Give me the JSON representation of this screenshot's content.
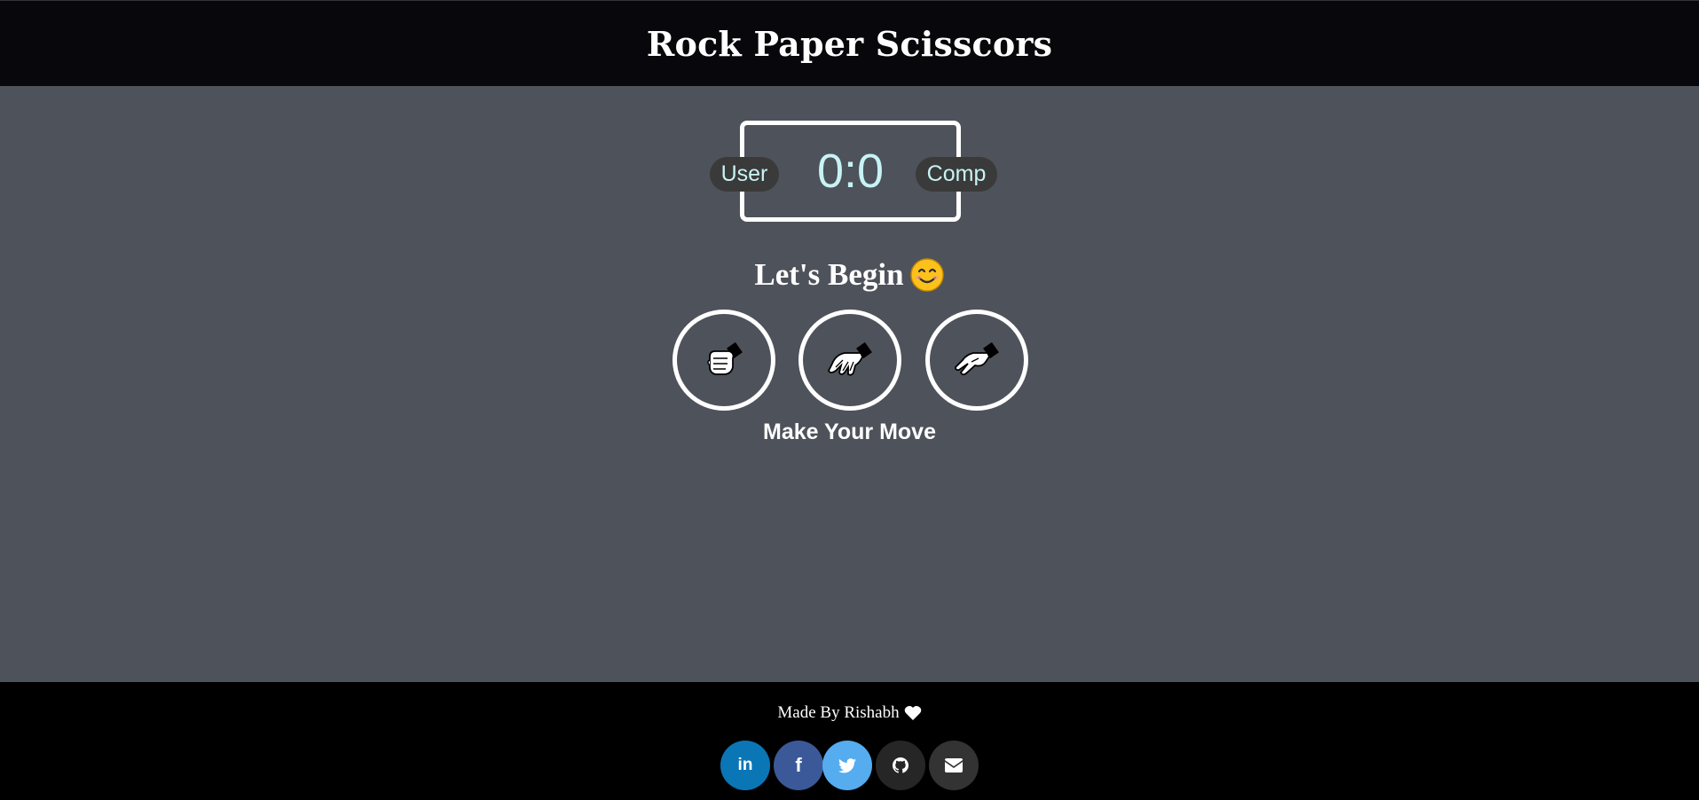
{
  "header": {
    "title": "Rock Paper Scisscors"
  },
  "scoreboard": {
    "user_label": "User",
    "comp_label": "Comp",
    "score": "0:0"
  },
  "message": {
    "text": "Let's Begin",
    "icon": "smiling-face-icon"
  },
  "choices": [
    {
      "name": "rock",
      "icon": "fist-icon"
    },
    {
      "name": "paper",
      "icon": "open-hand-icon"
    },
    {
      "name": "scissors",
      "icon": "two-fingers-icon"
    }
  ],
  "prompt": {
    "text": "Make Your Move"
  },
  "footer": {
    "credit": "Made By Rishabh",
    "heart_icon": "heart-icon",
    "socials": [
      {
        "name": "linkedin",
        "label": "in",
        "color": "#0a76b6"
      },
      {
        "name": "facebook",
        "label": "f",
        "color": "#3b5998"
      },
      {
        "name": "twitter",
        "label": "twitter-bird",
        "color": "#55acee"
      },
      {
        "name": "github",
        "label": "github-cat",
        "color": "#262626"
      },
      {
        "name": "email",
        "label": "envelope",
        "color": "#333333"
      }
    ]
  },
  "colors": {
    "page_bg": "#4e525b",
    "header_bg": "#08070b",
    "score_text": "#c7f3f4",
    "badge_bg": "#3a3a3a",
    "footer_bg": "#000000"
  }
}
